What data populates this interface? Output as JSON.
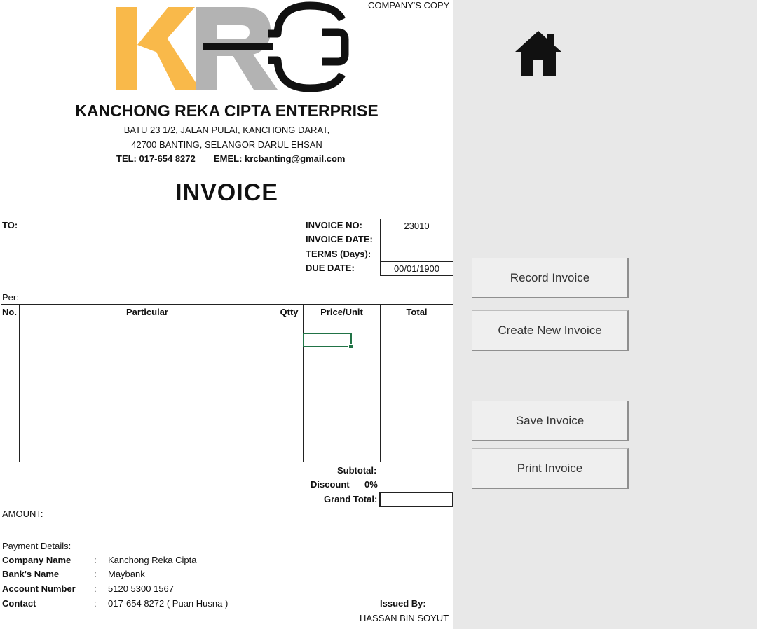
{
  "company_copy_label": "COMPANY'S COPY",
  "logo": {
    "text": "KRC",
    "colors": {
      "k": "#f9b94a",
      "r": "#b3b3b3",
      "c": "#111111"
    }
  },
  "company": {
    "name": "KANCHONG REKA CIPTA ENTERPRISE",
    "address_line1": "BATU 23 1/2, JALAN PULAI, KANCHONG DARAT,",
    "address_line2": "42700 BANTING, SELANGOR DARUL EHSAN",
    "tel": "TEL: 017-654 8272",
    "email": "EMEL: krcbanting@gmail.com"
  },
  "invoice_title": "INVOICE",
  "to_label": "TO:",
  "per_label": "Per:",
  "meta": {
    "invoice_no_label": "INVOICE NO:",
    "invoice_no_value": "23010",
    "invoice_date_label": "INVOICE DATE:",
    "invoice_date_value": "",
    "terms_label": "TERMS (Days):",
    "terms_value": "",
    "due_date_label": "DUE DATE:",
    "due_date_value": "00/01/1900"
  },
  "table": {
    "headers": [
      "No.",
      "Particular",
      "Qtty",
      "Price/Unit",
      "Total"
    ],
    "rows": []
  },
  "totals": {
    "subtotal_label": "Subtotal:",
    "discount_label": "Discount",
    "discount_value": "0%",
    "grand_total_label": "Grand Total:",
    "grand_total_value": ""
  },
  "amount_label": "AMOUNT:",
  "payment": {
    "title": "Payment Details:",
    "rows": [
      {
        "label": "Company Name",
        "sep": ":",
        "value": "Kanchong Reka Cipta"
      },
      {
        "label": "Bank's Name",
        "sep": ":",
        "value": "Maybank"
      },
      {
        "label": "Account Number",
        "sep": ":",
        "value": "5120 5300 1567"
      },
      {
        "label": "Contact",
        "sep": ":",
        "value": "017-654 8272 ( Puan Husna )"
      }
    ]
  },
  "issued_by_label": "Issued By:",
  "issued_by_name": "HASSAN BIN SOYUT",
  "home_icon": "home-icon",
  "buttons": {
    "record": "Record Invoice",
    "create": "Create New Invoice",
    "save": "Save Invoice",
    "print": "Print Invoice"
  }
}
